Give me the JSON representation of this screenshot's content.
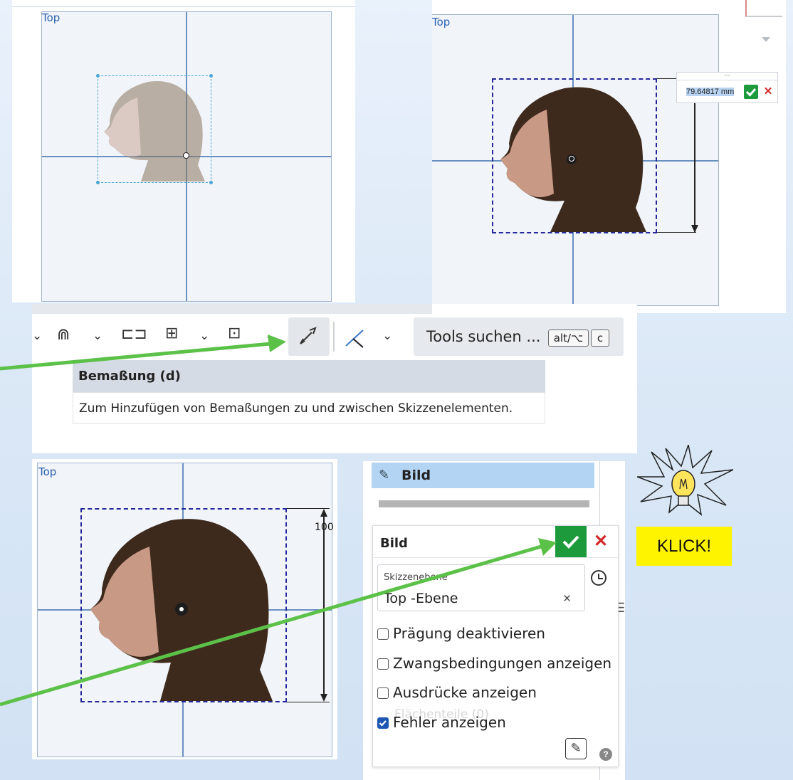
{
  "canvas_labels": {
    "top_left": "Top",
    "top_right": "Top",
    "bottom_left": "Top"
  },
  "dimension_input": {
    "value": "79.64817 mm",
    "confirm_icon": "check-icon",
    "cancel_icon": "close-icon"
  },
  "dimension_label": "100",
  "toolbar": {
    "search_label": "Tools suchen ...",
    "shortcut_key_1": "alt/⌥",
    "shortcut_key_2": "c"
  },
  "tooltip": {
    "title": "Bemaßung (d)",
    "description": "Zum Hinzufügen von Bemaßungen zu und zwischen Skizzenelementen."
  },
  "feature_list": {
    "item_label": "Bild"
  },
  "dialog": {
    "title": "Bild",
    "field_label": "Skizzenebene",
    "field_value": "Top -Ebene",
    "field_clear": "×",
    "faded_text": "Flächenteile (0)",
    "options": [
      {
        "label": "Prägung deaktivieren",
        "checked": false
      },
      {
        "label": "Zwangsbedingungen anzeigen",
        "checked": false
      },
      {
        "label": "Ausdrücke anzeigen",
        "checked": false
      },
      {
        "label": "Fehler anzeigen",
        "checked": true
      }
    ],
    "help": "?"
  },
  "callout": {
    "text": "KLICK!"
  },
  "colors": {
    "arrow": "#5cc148",
    "accent_blue": "#1e56b4",
    "confirm_green": "#1d9a3b",
    "cancel_red": "#d42828",
    "highlight_yellow": "#fff400"
  }
}
